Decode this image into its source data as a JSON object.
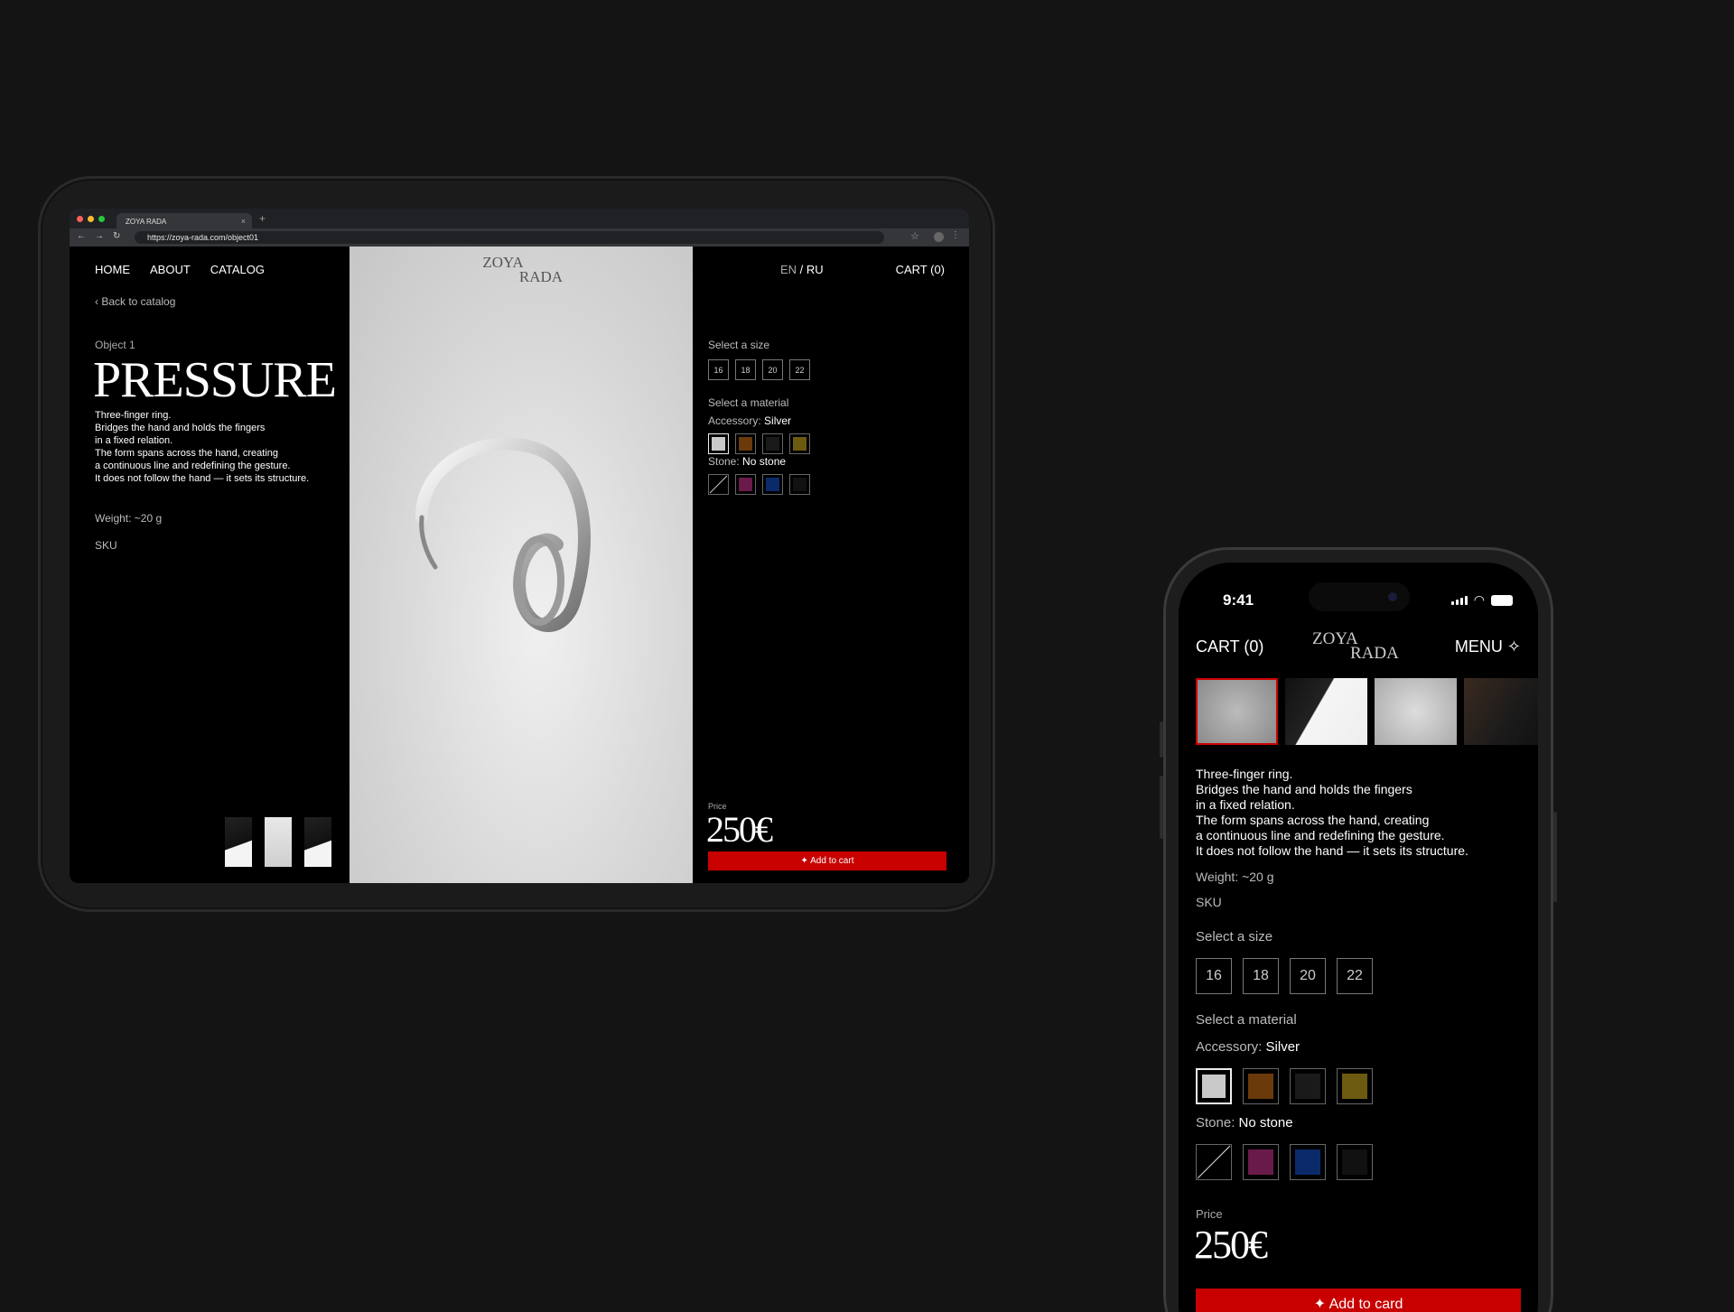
{
  "browser": {
    "tab_title": "ZOYA RADA",
    "tab_close": "×",
    "new_tab": "+",
    "url": "https://zoya-rada.com/object01",
    "dots": [
      "#ff5f57",
      "#febc2e",
      "#28c840"
    ]
  },
  "brand": {
    "logo_line1": "ZOYA",
    "logo_line2": "RADA"
  },
  "nav": {
    "home": "HOME",
    "about": "ABOUT",
    "catalog": "CATALOG",
    "back": "‹ Back to catalog",
    "lang_en": "EN",
    "lang_sep": " / ",
    "lang_ru": "RU",
    "cart": "CART (0)",
    "menu": "MENU ✧"
  },
  "product": {
    "object_num": "Object 1",
    "title": "PRESSURE",
    "description": [
      "Three-finger ring.",
      "Bridges the hand and holds the fingers",
      "in a fixed relation.",
      "The form spans across the hand, creating",
      "a continuous line and redefining the gesture.",
      "It does not follow the hand — it sets its structure."
    ],
    "weight": "Weight: ~20 g",
    "sku": "SKU",
    "price_label": "Price",
    "price": "250€"
  },
  "options": {
    "size_label": "Select a size",
    "sizes": [
      "16",
      "18",
      "20",
      "22"
    ],
    "material_label": "Select a material",
    "accessory_label": "Accessory:",
    "accessory_value": "Silver",
    "accessory_colors": [
      "#c9c9c9",
      "#6a3a0a",
      "#1a1a1a",
      "#6b5a10"
    ],
    "stone_label": "Stone:",
    "stone_value": "No stone",
    "stone_colors": [
      "none",
      "#6a1a4a",
      "#0a2a6a",
      "#111111"
    ]
  },
  "actions": {
    "add_tablet": "✦ Add to cart",
    "add_phone": "✦ Add to card"
  },
  "status": {
    "time": "9:41"
  }
}
